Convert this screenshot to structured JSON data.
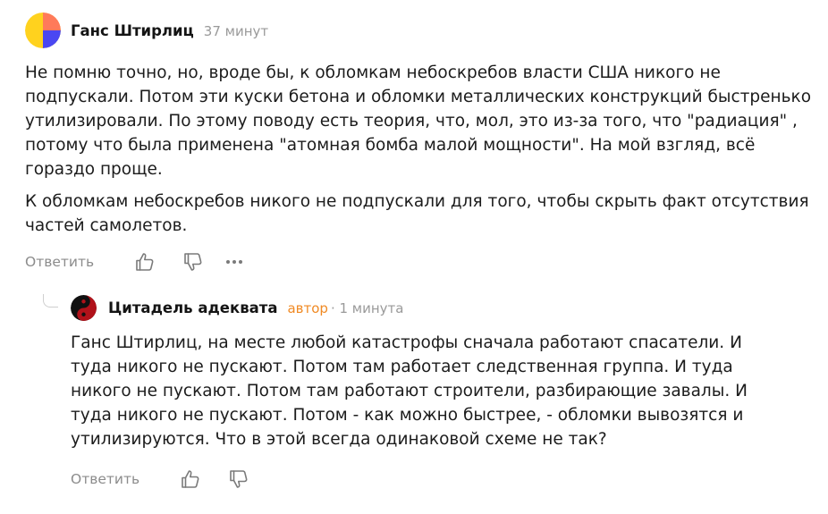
{
  "comment": {
    "author": "Ганс Штирлиц",
    "time": "37 минут",
    "avatar": {
      "icon": "yellow-blue-orange-circle-avatar",
      "colors": [
        "#ffd21e",
        "#4a47f2",
        "#ff7a5a"
      ]
    },
    "paragraphs": [
      "Не помню точно, но, вроде бы, к обломкам небоскребов власти США никого не подпускали. Потом эти куски бетона и обломки металлических конструкций быстренько утилизировали. По этому поводу есть теория, что, мол, это из-за того, что \"радиация\" , потому что была применена \"атомная бомба малой мощности\". На мой взгляд, всё гораздо проще.",
      "К обломкам небоскребов никого не подпускали для того, чтобы скрыть факт отсутствия частей самолетов."
    ],
    "actions": {
      "reply_label": "Ответить",
      "like_icon": "thumbs-up-icon",
      "dislike_icon": "thumbs-down-icon",
      "more_icon": "more-dots-icon"
    }
  },
  "reply": {
    "author": "Цитадель адеквата",
    "badge": "автор",
    "time": "· 1 минута",
    "avatar": {
      "icon": "red-black-yin-yang-avatar",
      "colors": [
        "#b1121a",
        "#111111"
      ]
    },
    "paragraphs": [
      "Ганс Штирлиц, на месте любой катастрофы сначала работают спасатели. И туда никого не пускают. Потом там работает следственная группа. И туда никого не пускают. Потом там работают строители, разбирающие завалы. И туда никого не пускают. Потом - как можно быстрее, - обломки вывозятся и утилизируются. Что в этой всегда одинаковой схеме не так?"
    ],
    "actions": {
      "reply_label": "Ответить",
      "like_icon": "thumbs-up-icon",
      "dislike_icon": "thumbs-down-icon"
    }
  },
  "colors": {
    "text": "#1c1c1c",
    "muted": "#8c8c8c",
    "author_badge": "#f08a24"
  }
}
